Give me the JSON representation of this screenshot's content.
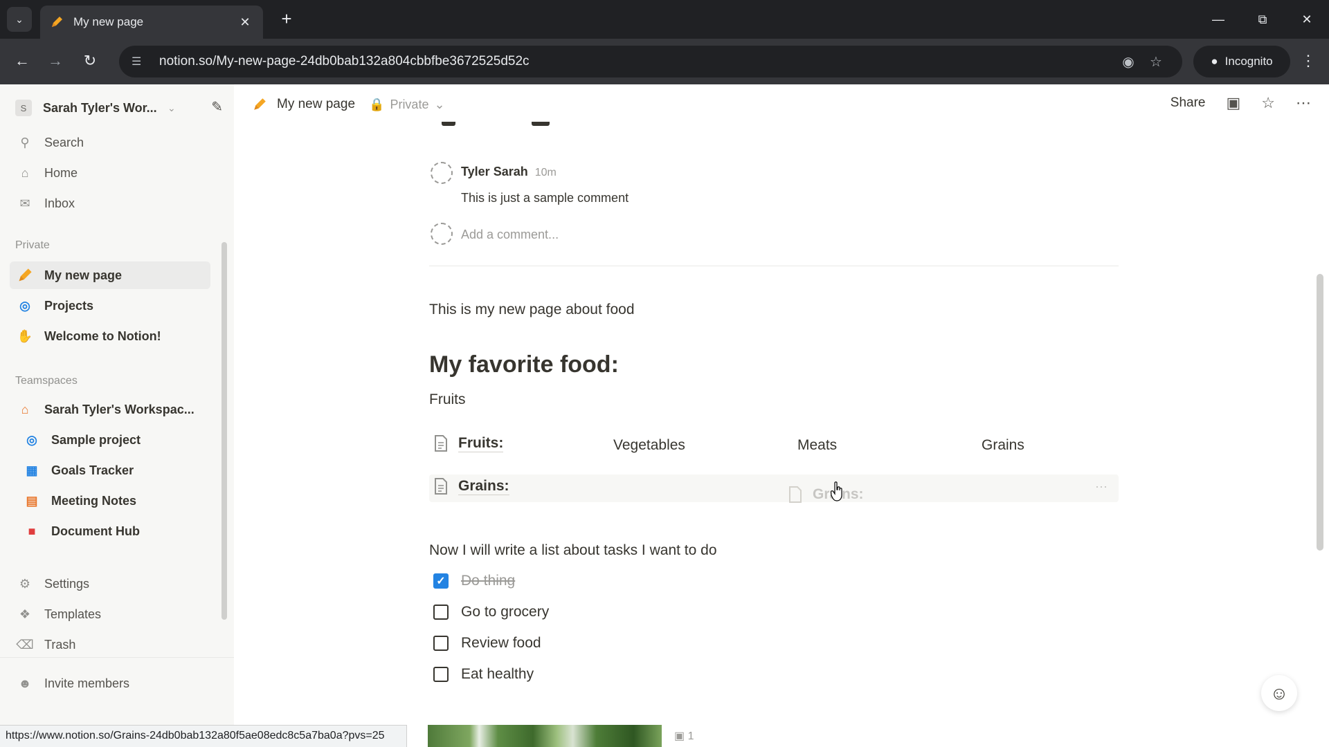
{
  "browser": {
    "tab_title": "My new page",
    "url": "notion.so/My-new-page-24db0bab132a804cbbfbe3672525d52c",
    "incognito_label": "Incognito",
    "status_url": "https://www.notion.so/Grains-24db0bab132a80f5ae08edc8c5a7ba0a?pvs=25"
  },
  "sidebar": {
    "workspace_badge": "S",
    "workspace_name": "Sarah Tyler's Wor...",
    "top_items": [
      {
        "label": "Search",
        "icon": "search-icon"
      },
      {
        "label": "Home",
        "icon": "home-icon"
      },
      {
        "label": "Inbox",
        "icon": "inbox-icon"
      }
    ],
    "private_label": "Private",
    "private_items": [
      {
        "label": "My new page",
        "icon": "pencil-icon"
      },
      {
        "label": "Projects",
        "icon": "projects-icon"
      },
      {
        "label": "Welcome to Notion!",
        "icon": "wave-icon"
      }
    ],
    "teamspaces_label": "Teamspaces",
    "teamspace_name": "Sarah Tyler's Workspac...",
    "teamspace_items": [
      {
        "label": "Sample project",
        "icon": "target-icon"
      },
      {
        "label": "Goals Tracker",
        "icon": "chart-icon"
      },
      {
        "label": "Meeting Notes",
        "icon": "calendar-icon"
      },
      {
        "label": "Document Hub",
        "icon": "document-icon"
      }
    ],
    "bottom_items": [
      {
        "label": "Settings",
        "icon": "gear-icon"
      },
      {
        "label": "Templates",
        "icon": "templates-icon"
      },
      {
        "label": "Trash",
        "icon": "trash-icon"
      }
    ],
    "invite_label": "Invite members"
  },
  "pagebar": {
    "title": "My new page",
    "privacy": "Private",
    "share_label": "Share"
  },
  "comment": {
    "author": "Tyler Sarah",
    "time": "10m",
    "text": "This is just a sample comment",
    "add_placeholder": "Add a comment..."
  },
  "content": {
    "intro": "This is my new page about food",
    "heading": "My favorite food:",
    "fruits_text": "Fruits",
    "columns_row1": {
      "page": "Fruits:",
      "col2": "Vegetables",
      "col3": "Meats",
      "col4": "Grains"
    },
    "row2_page": "Grains:",
    "ghost_page": "Grains:",
    "list_intro": "Now I will write a list about tasks I want to do",
    "todos": [
      {
        "label": "Do thing",
        "checked": true
      },
      {
        "label": "Go to grocery",
        "checked": false
      },
      {
        "label": "Review food",
        "checked": false
      },
      {
        "label": "Eat healthy",
        "checked": false
      }
    ],
    "image_comment_count": "1"
  },
  "colors": {
    "accent": "#2383e2",
    "sidebar_bg": "#f7f7f5",
    "text": "#37352f"
  }
}
